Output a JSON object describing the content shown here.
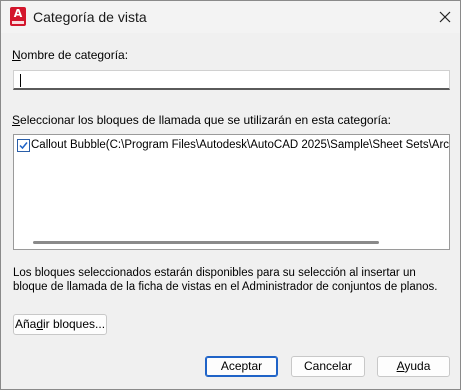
{
  "window": {
    "title": "Categoría de vista",
    "app_icon_letter": "A"
  },
  "category_name": {
    "label_underlined_char": "N",
    "label_rest": "ombre de categoría:",
    "value": ""
  },
  "blocks": {
    "label_underlined_char": "S",
    "label_rest": "eleccionar los bloques de llamada que se utilizarán en esta categoría:",
    "items": [
      {
        "checked": true,
        "text": "Callout Bubble(C:\\Program Files\\Autodesk\\AutoCAD 2025\\Sample\\Sheet Sets\\Architecture"
      }
    ]
  },
  "info_text": "Los bloques seleccionados estarán disponibles para su selección al insertar un bloque de llamada de la ficha de vistas en el Administrador de conjuntos de planos.",
  "buttons": {
    "add_blocks_pre": "Aña",
    "add_blocks_underlined": "d",
    "add_blocks_post": "ir bloques...",
    "accept": "Aceptar",
    "cancel": "Cancelar",
    "help_underlined": "A",
    "help_rest": "yuda"
  },
  "colors": {
    "accent": "#1f63c7",
    "app_icon": "#d3162c"
  }
}
